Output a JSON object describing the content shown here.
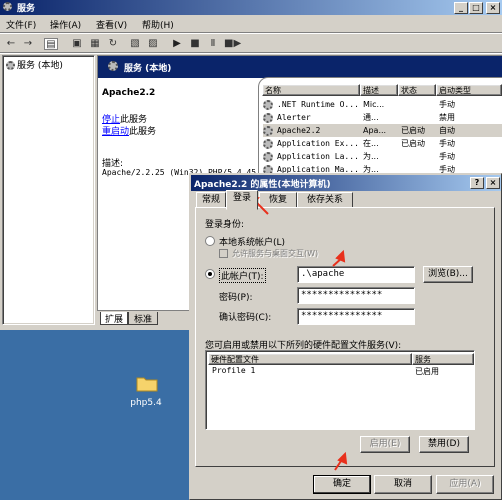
{
  "main_window": {
    "title": "服务",
    "menu": [
      "文件(F)",
      "操作(A)",
      "查看(V)",
      "帮助(H)"
    ],
    "tree_root": "服务 (本地)",
    "header_title": "服务 (本地)",
    "selected_service": "Apache2.2",
    "stop_link": "停止",
    "stop_suffix": "此服务",
    "restart_link": "重启动",
    "restart_suffix": "此服务",
    "desc_label": "描述:",
    "desc_text": "Apache/2.2.25 (Win32) PHP/5.4.45",
    "bottom_tabs": [
      "扩展",
      "标准"
    ]
  },
  "service_list": {
    "columns": [
      "名称",
      "描述",
      "状态",
      "启动类型"
    ],
    "rows": [
      {
        "name": ".NET Runtime O...",
        "desc": "Mic...",
        "status": "",
        "startup": "手动"
      },
      {
        "name": "Alerter",
        "desc": "通...",
        "status": "",
        "startup": "禁用"
      },
      {
        "name": "Apache2.2",
        "desc": "Apa...",
        "status": "已启动",
        "startup": "自动"
      },
      {
        "name": "Application Ex...",
        "desc": "在...",
        "status": "已启动",
        "startup": "手动"
      },
      {
        "name": "Application La...",
        "desc": "为...",
        "status": "",
        "startup": "手动"
      },
      {
        "name": "Application Ma...",
        "desc": "为...",
        "status": "",
        "startup": "手动"
      }
    ]
  },
  "desktop": {
    "icon_label": "php5.4"
  },
  "dialog": {
    "title": "Apache2.2 的属性(本地计算机)",
    "help_btn": "?",
    "close_btn": "×",
    "tabs": [
      "常规",
      "登录",
      "恢复",
      "依存关系"
    ],
    "logon_as": "登录身份:",
    "local_system": "本地系统帐户(L)",
    "allow_desktop": "允许服务与桌面交互(W)",
    "this_account": "此帐户(T):",
    "account_value": ".\\apache",
    "browse": "浏览(B)...",
    "password_label": "密码(P):",
    "password_value": "***************",
    "confirm_label": "确认密码(C):",
    "confirm_value": "***************",
    "hw_desc": "您可启用或禁用以下所列的硬件配置文件服务(V):",
    "hw_columns": [
      "硬件配置文件",
      "服务"
    ],
    "hw_rows": [
      {
        "profile": "Profile 1",
        "service": "已启用"
      }
    ],
    "enable_btn": "启用(E)",
    "disable_btn": "禁用(D)",
    "ok": "确定",
    "cancel": "取消",
    "apply": "应用(A)"
  },
  "colors": {
    "desktop": "#3a6ea5",
    "title_active": "#0a246a",
    "arrow": "#e8301c"
  }
}
